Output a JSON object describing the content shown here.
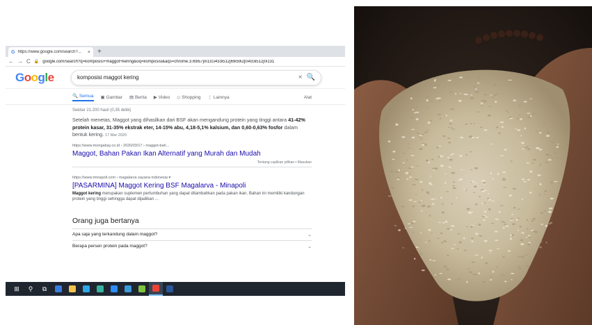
{
  "browser": {
    "tab": {
      "title": "https://www.google.com/search?...",
      "close": "×",
      "new_tab": "+"
    },
    "toolbar": {
      "back": "←",
      "forward": "→",
      "reload": "C",
      "url": "google.com/search?q=komposisi+maggot+kering&oq=komposisi&aqs=chrome.3.69i57j0i131i433i512j69i59i2j0i433i512j0i131"
    },
    "google": {
      "logo": [
        "G",
        "o",
        "o",
        "g",
        "l",
        "e"
      ],
      "query": "komposisi maggot kering",
      "clear_icon": "×",
      "search_icon": "🔍",
      "filters": [
        "Semua",
        "Gambar",
        "Berita",
        "Video",
        "Shopping",
        "Lainnya"
      ],
      "filter_icons": [
        "🔍",
        "▣",
        "▤",
        "▶",
        "◇",
        "⋮"
      ],
      "tools": "Alat",
      "stats": "Sekitar 21.200 hasil (0,35 detik)"
    },
    "featured": {
      "text_1": "Setelah menetas, Maggot yang dihasilkan dari BSF akan mengandung protein yang tinggi antara ",
      "bold_1": "41-42% protein kasar, 31-35% ekstrak eter, 14-15% abu, 4,18-5,1% kalsium, dan 0,60-0,63% fosfor",
      "text_2": " dalam bentuk kering.",
      "date": "17 Mar 2020",
      "cite": "https://www.mongabay.co.id › 2020/03/17 › maggot-bah...",
      "title": "Maggot, Bahan Pakan Ikan Alternatif yang Murah dan Mudah",
      "about": "Tentang cuplikan pilihan",
      "sep": "•",
      "feedback": "Masukan"
    },
    "result2": {
      "cite": "https://www.minapoli.com › magalarva sayana indonesia ▾",
      "title": "[PASARMINA] Maggot Kering BSF Magalarva - Minapoli",
      "desc_bold": "Maggot kering",
      "desc_rest": " merupakan suplemen pertumbuhan yang dapat ditambahkan pada pakan ikan. Bahan ini memiliki kandungan protein yang tinggi sehingga dapat dijadikan ..."
    },
    "paa": {
      "title": "Orang juga bertanya",
      "items": [
        "Apa saja yang terkandung dalam maggot?",
        "Berapa persen protein pada maggot?"
      ],
      "chevron": "⌄"
    },
    "taskbar": {
      "icons": [
        "windows-start",
        "search",
        "task-view",
        "app-1",
        "files",
        "edge",
        "app-2",
        "zoom",
        "vscode",
        "notes",
        "chrome",
        "word"
      ],
      "glyphs": [
        "⊞",
        "⚲",
        "⧉",
        "",
        "",
        "",
        "",
        "",
        "",
        "",
        "",
        ""
      ],
      "colors": [
        "#ffffff",
        "#ffffff",
        "#ffffff",
        "#3b7ddd",
        "#f2c14e",
        "#2fa6e8",
        "#38b2a0",
        "#2d8cff",
        "#3c99dc",
        "#7fc241",
        "#ea4335",
        "#2b579a"
      ]
    }
  }
}
